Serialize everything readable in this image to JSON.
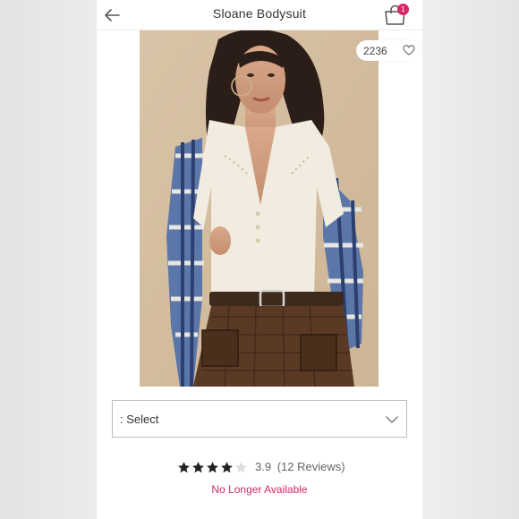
{
  "header": {
    "title": "Sloane Bodysuit",
    "cart_count": "1",
    "back_icon": "arrow-left-icon",
    "cart_icon": "shopping-bag-icon"
  },
  "product": {
    "like_count": "2236",
    "like_icon": "heart-icon"
  },
  "size_select": {
    "label": ": Select",
    "icon": "chevron-down-icon"
  },
  "rating": {
    "value": 3.9,
    "value_text": "3.9",
    "reviews_text": "(12 Reviews)",
    "stars_filled": 4,
    "stars_total": 5
  },
  "availability": {
    "status": "No Longer Available"
  },
  "colors": {
    "accent": "#d6276a",
    "star_filled": "#222222",
    "star_empty": "#dddddd"
  }
}
